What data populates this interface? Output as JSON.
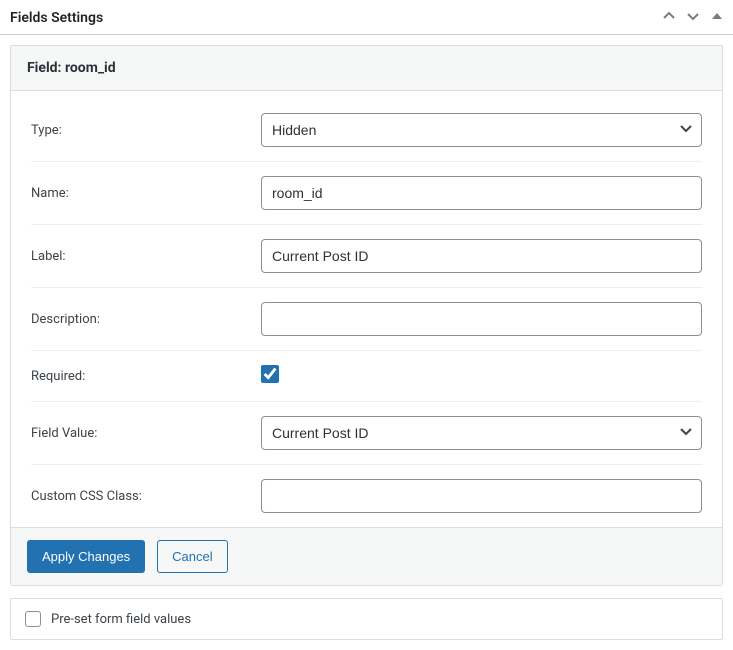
{
  "panel": {
    "title": "Fields Settings"
  },
  "field": {
    "header_prefix": "Field: ",
    "header_name": "room_id",
    "type_label": "Type:",
    "type_value": "Hidden",
    "name_label": "Name:",
    "name_value": "room_id",
    "label_label": "Label:",
    "label_value": "Current Post ID",
    "description_label": "Description:",
    "description_value": "",
    "required_label": "Required:",
    "required_checked": true,
    "fieldvalue_label": "Field Value:",
    "fieldvalue_value": "Current Post ID",
    "cssclass_label": "Custom CSS Class:",
    "cssclass_value": ""
  },
  "buttons": {
    "apply": "Apply Changes",
    "cancel": "Cancel"
  },
  "preset": {
    "label": "Pre-set form field values",
    "checked": false
  }
}
